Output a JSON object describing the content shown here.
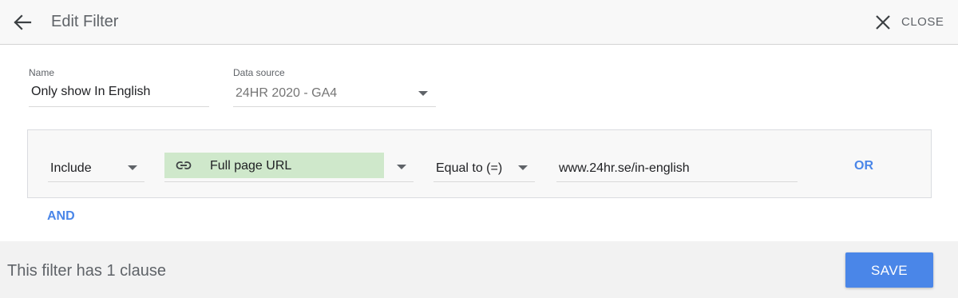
{
  "header": {
    "title": "Edit Filter",
    "close_label": "CLOSE"
  },
  "form": {
    "name_label": "Name",
    "name_value": "Only show In English",
    "data_source_label": "Data source",
    "data_source_value": "24HR 2020 - GA4"
  },
  "clause": {
    "include_value": "Include",
    "dimension_value": "Full page URL",
    "dimension_icon": "link-icon",
    "condition_value": "Equal to (=)",
    "match_value": "www.24hr.se/in-english",
    "or_label": "OR"
  },
  "and_label": "AND",
  "footer": {
    "status_text": "This filter has 1 clause",
    "save_label": "SAVE"
  },
  "colors": {
    "accent": "#4a86e8",
    "chip_green": "#cfe8cb",
    "header_bg": "#f8f8f8",
    "footer_bg": "#f2f2f2"
  }
}
